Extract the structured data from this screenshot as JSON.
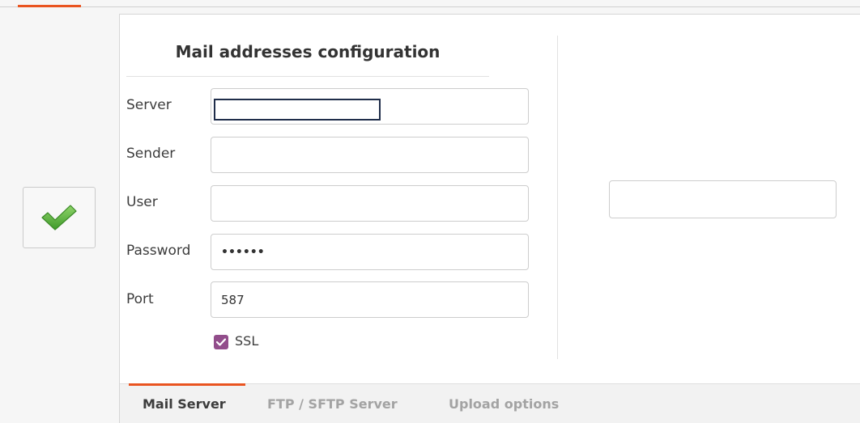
{
  "colors": {
    "accent": "#e95420",
    "checkbox": "#924d8b",
    "check_icon": "#5bb53c"
  },
  "toolbar": {
    "apply_icon": "checkmark-icon"
  },
  "mail_config": {
    "title": "Mail addresses configuration",
    "fields": {
      "server": {
        "label": "Server",
        "value": ""
      },
      "sender": {
        "label": "Sender",
        "value": ""
      },
      "user": {
        "label": "User",
        "value": ""
      },
      "password": {
        "label": "Password",
        "value": "••••••"
      },
      "port": {
        "label": "Port",
        "value": "587"
      }
    },
    "ssl": {
      "label": "SSL",
      "checked": true
    }
  },
  "side_field": {
    "value": ""
  },
  "tabs": [
    {
      "label": "Mail Server",
      "active": true
    },
    {
      "label": "FTP / SFTP  Server",
      "active": false
    },
    {
      "label": "Upload options",
      "active": false
    }
  ]
}
